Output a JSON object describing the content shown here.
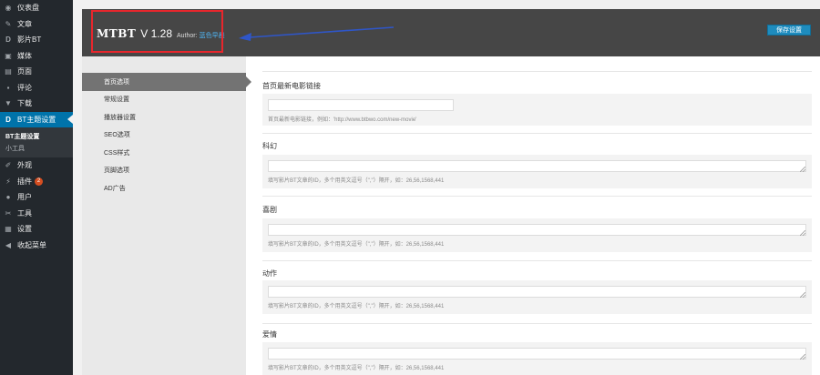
{
  "sidebar": {
    "items": [
      {
        "label": "仪表盘",
        "icon": "dashboard-icon",
        "glyph": "◉"
      },
      {
        "label": "文章",
        "icon": "pin-icon",
        "glyph": "✎"
      },
      {
        "label": "影片BT",
        "icon": "d-logo-icon",
        "glyph": "D"
      },
      {
        "label": "媒体",
        "icon": "media-icon",
        "glyph": "▣"
      },
      {
        "label": "页面",
        "icon": "page-icon",
        "glyph": "▤"
      },
      {
        "label": "评论",
        "icon": "comment-icon",
        "glyph": "▪"
      },
      {
        "label": "下载",
        "icon": "download-icon",
        "glyph": "▼"
      },
      {
        "label": "BT主题设置",
        "icon": "d-logo-icon",
        "glyph": "D",
        "current": true
      }
    ],
    "submenu": [
      "BT主题设置",
      "小工具"
    ],
    "items_after": [
      {
        "label": "外观",
        "icon": "brush-icon",
        "glyph": "✐"
      },
      {
        "label": "插件",
        "icon": "plugin-icon",
        "glyph": "⚡",
        "badge": "2"
      },
      {
        "label": "用户",
        "icon": "user-icon",
        "glyph": "●"
      },
      {
        "label": "工具",
        "icon": "wrench-icon",
        "glyph": "✂"
      },
      {
        "label": "设置",
        "icon": "settings-icon",
        "glyph": "▦"
      },
      {
        "label": "收起菜单",
        "icon": "collapse-icon",
        "glyph": "◀"
      }
    ]
  },
  "header": {
    "theme_name": "MTBT",
    "version": "V 1.28",
    "author_prefix": "Author:",
    "author_name": "蓝色早晨",
    "save_label": "保存设置"
  },
  "tabs": [
    "首页选项",
    "常规设置",
    "播放器设置",
    "SEO选项",
    "CSS样式",
    "页脚选项",
    "AD广告"
  ],
  "active_tab": 0,
  "fields": {
    "latest": {
      "label": "首页最新电影链接",
      "value": "",
      "placeholder": "",
      "desc": "首页最新电影链接，例如：'http://www.btbwo.com/new-movie'"
    },
    "areas": [
      {
        "label": "科幻",
        "desc": "填写影片BT文章的ID，多个用英文逗号（\",\"）隔开，如：26,56,1568,441"
      },
      {
        "label": "喜剧",
        "desc": "填写影片BT文章的ID，多个用英文逗号（\",\"）隔开，如：26,56,1568,441"
      },
      {
        "label": "动作",
        "desc": "填写影片BT文章的ID，多个用英文逗号（\",\"）隔开，如：26,56,1568,441"
      },
      {
        "label": "爱情",
        "desc": "填写影片BT文章的ID，多个用英文逗号（\",\"）隔开，如：26,56,1568,441"
      }
    ]
  },
  "colors": {
    "sidebar_bg": "#23282d",
    "accent": "#0073aa",
    "header_bg": "#464646",
    "highlight": "#e8262c",
    "arrow": "#2f56c8"
  }
}
